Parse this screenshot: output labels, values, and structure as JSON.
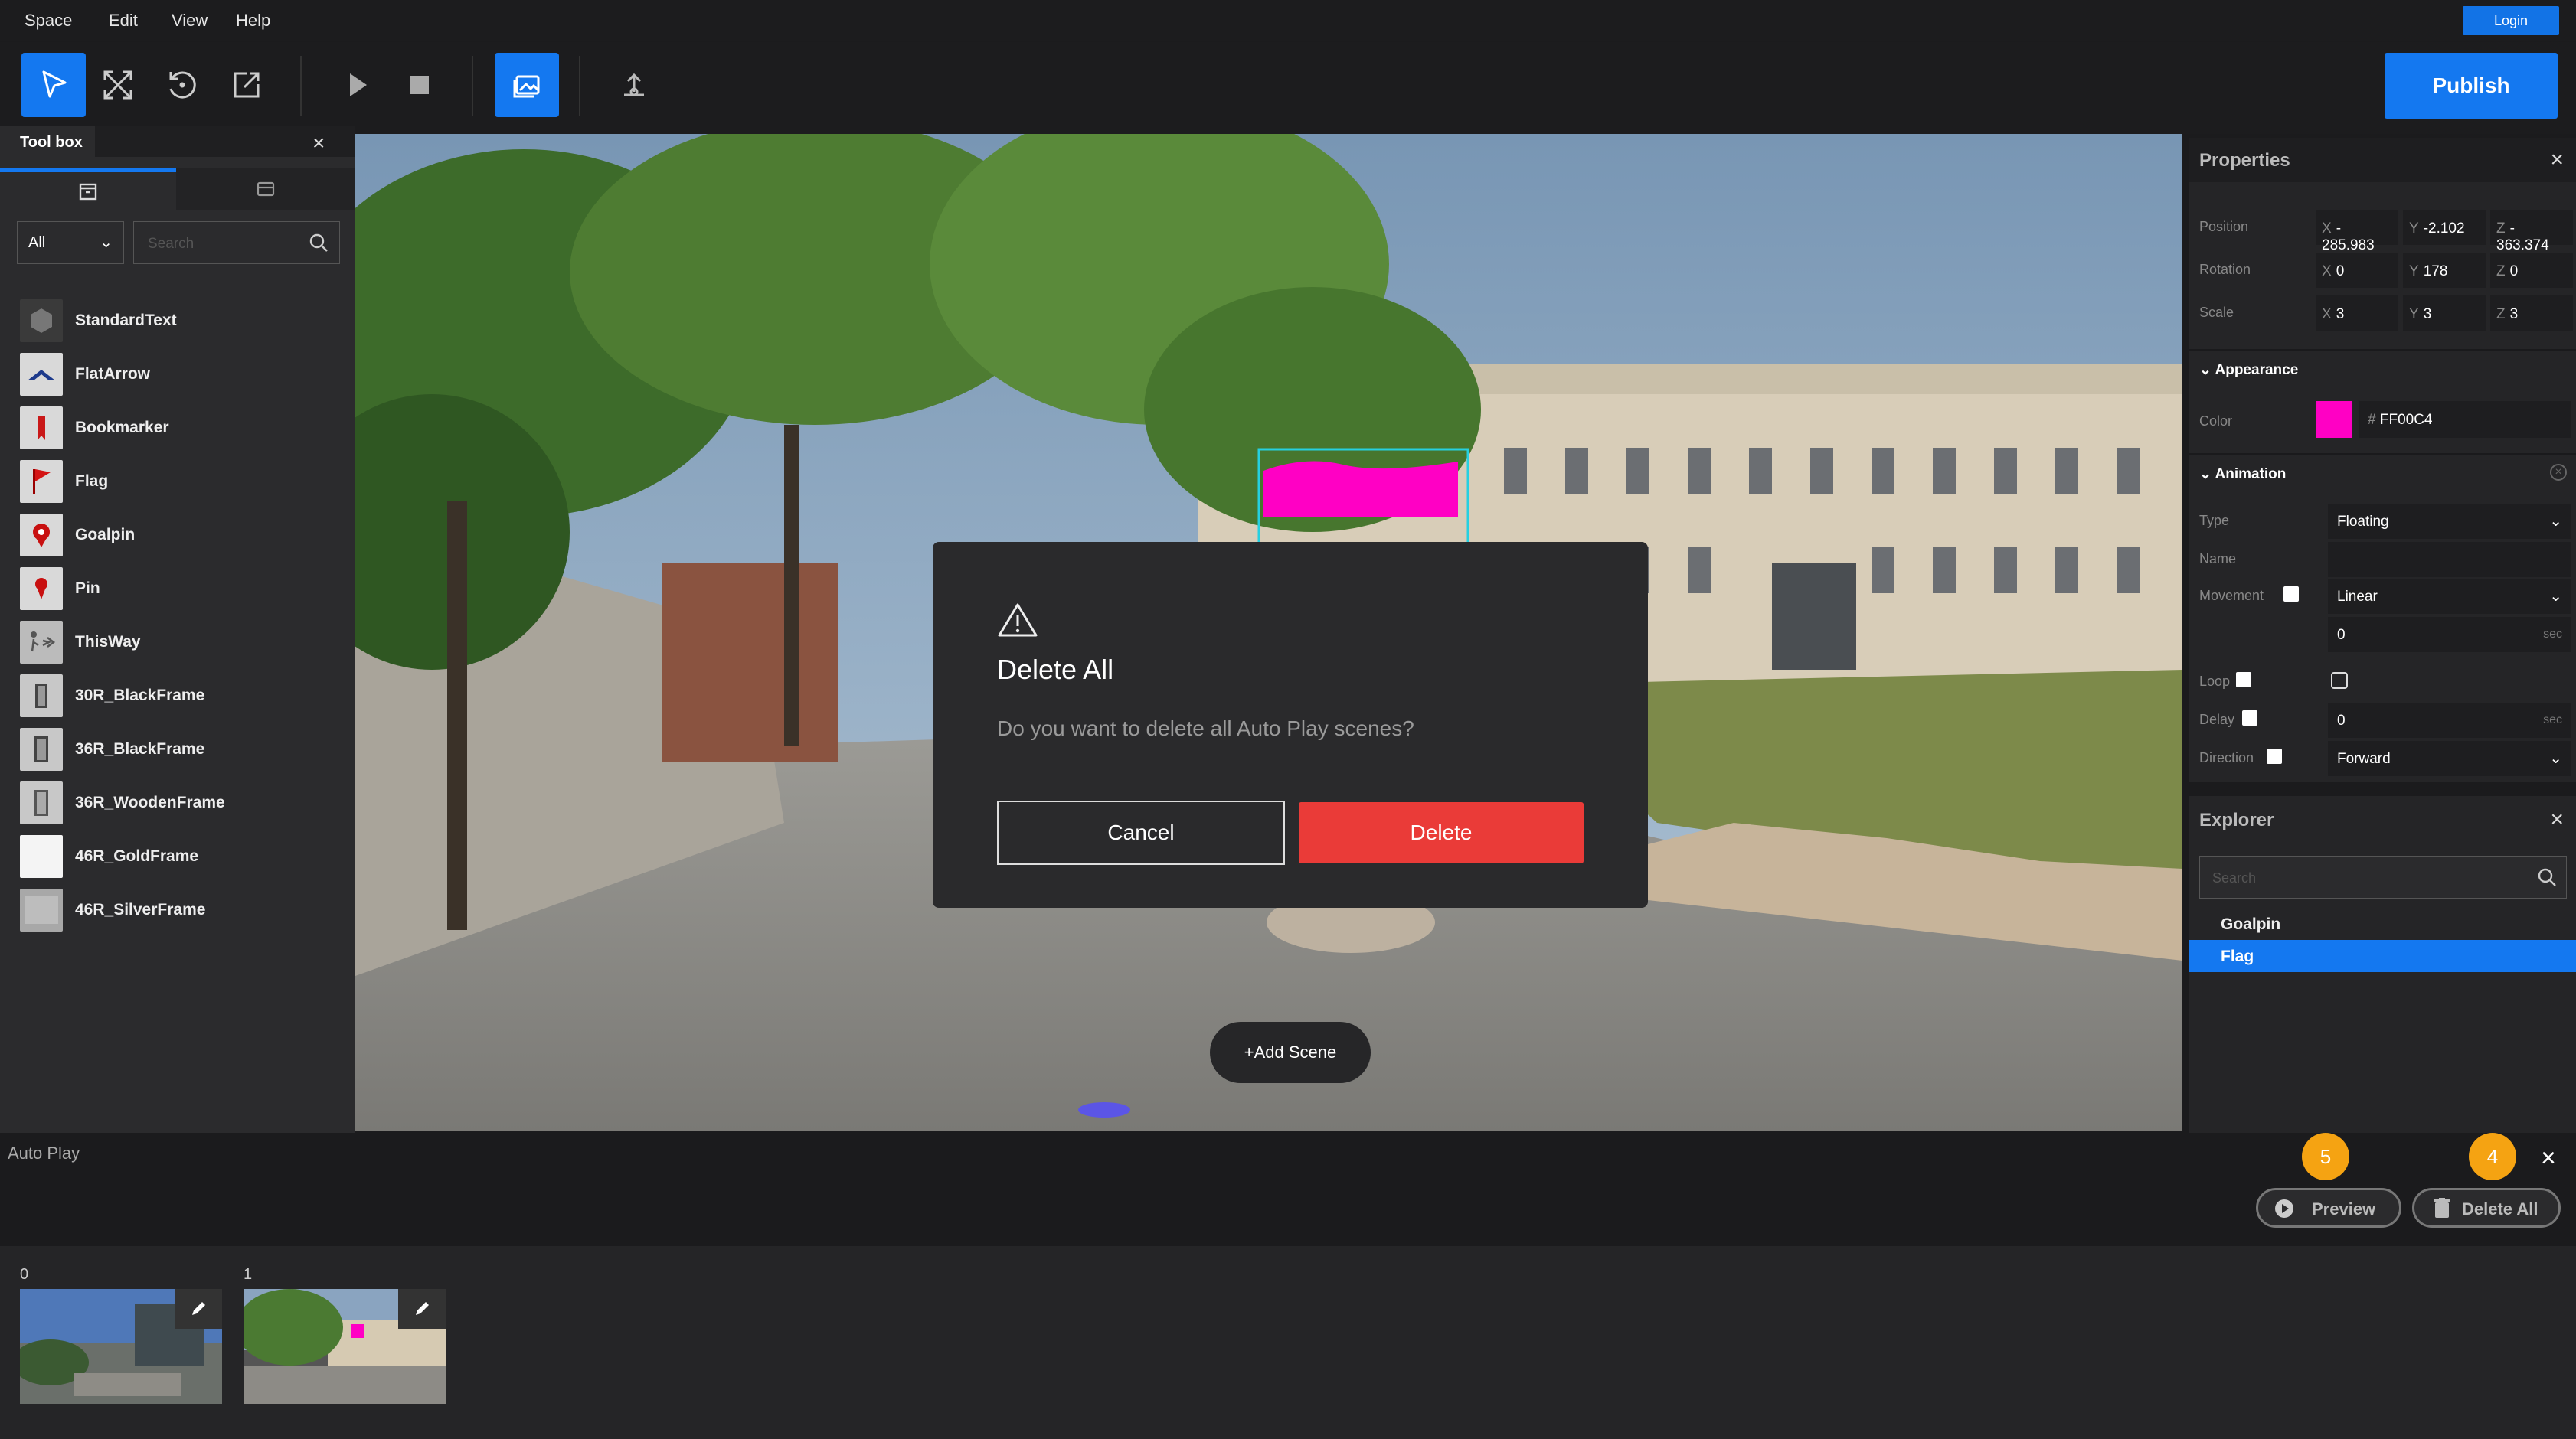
{
  "menu": {
    "items": [
      "Space",
      "Edit",
      "View",
      "Help"
    ],
    "login_label": "Login"
  },
  "toolbar": {
    "tools": [
      "select-icon",
      "move-icon",
      "rotate-icon",
      "scale-icon",
      "play-icon",
      "stop-icon",
      "image-icon",
      "upload-icon"
    ],
    "publish_label": "Publish"
  },
  "toolbox": {
    "tab_label": "Tool box",
    "filter_value": "All",
    "search_placeholder": "Search",
    "items": [
      {
        "label": "StandardText",
        "icon": "cube-icon"
      },
      {
        "label": "FlatArrow",
        "icon": "arrow-icon"
      },
      {
        "label": "Bookmarker",
        "icon": "bookmark-icon"
      },
      {
        "label": "Flag",
        "icon": "flag-icon"
      },
      {
        "label": "Goalpin",
        "icon": "goalpin-icon"
      },
      {
        "label": "Pin",
        "icon": "pin-icon"
      },
      {
        "label": "ThisWay",
        "icon": "thisway-icon"
      },
      {
        "label": "30R_BlackFrame",
        "icon": "frame-icon"
      },
      {
        "label": "36R_BlackFrame",
        "icon": "frame-icon"
      },
      {
        "label": "36R_WoodenFrame",
        "icon": "frame-icon"
      },
      {
        "label": "46R_GoldFrame",
        "icon": "frame-icon"
      },
      {
        "label": "46R_SilverFrame",
        "icon": "frame-icon"
      }
    ]
  },
  "viewport": {
    "add_scene_label": "+Add Scene",
    "accent": "#ff00c4"
  },
  "modal": {
    "title": "Delete All",
    "message": "Do you want to delete all Auto Play scenes?",
    "cancel_label": "Cancel",
    "delete_label": "Delete",
    "delete_color": "#ea3b38"
  },
  "properties": {
    "title": "Properties",
    "position": {
      "label": "Position",
      "x": "-285.983",
      "y": "-2.102",
      "z": "-363.374"
    },
    "rotation": {
      "label": "Rotation",
      "x": "0",
      "y": "178",
      "z": "0"
    },
    "scale": {
      "label": "Scale",
      "x": "3",
      "y": "3",
      "z": "3"
    },
    "appearance": {
      "title": "Appearance",
      "color_label": "Color",
      "color_hex": "FF00C4",
      "color": "#ff00c4",
      "hash": "#"
    },
    "animation": {
      "title": "Animation",
      "type_label": "Type",
      "type_value": "Floating",
      "name_label": "Name",
      "movement_label": "Movement",
      "movement_value": "Linear",
      "duration_value": "0",
      "duration_unit": "sec",
      "loop_label": "Loop",
      "delay_label": "Delay",
      "delay_value": "0",
      "delay_unit": "sec",
      "direction_label": "Direction",
      "direction_value": "Forward"
    },
    "axes": [
      "X",
      "Y",
      "Z"
    ]
  },
  "explorer": {
    "title": "Explorer",
    "search_placeholder": "Search",
    "items": [
      {
        "label": "Goalpin",
        "selected": false
      },
      {
        "label": "Flag",
        "selected": true
      }
    ]
  },
  "autoplay": {
    "title": "Auto Play",
    "badges": [
      "5",
      "4"
    ],
    "preview_label": "Preview",
    "delete_all_label": "Delete All",
    "scenes": [
      {
        "index": "0"
      },
      {
        "index": "1"
      }
    ]
  }
}
